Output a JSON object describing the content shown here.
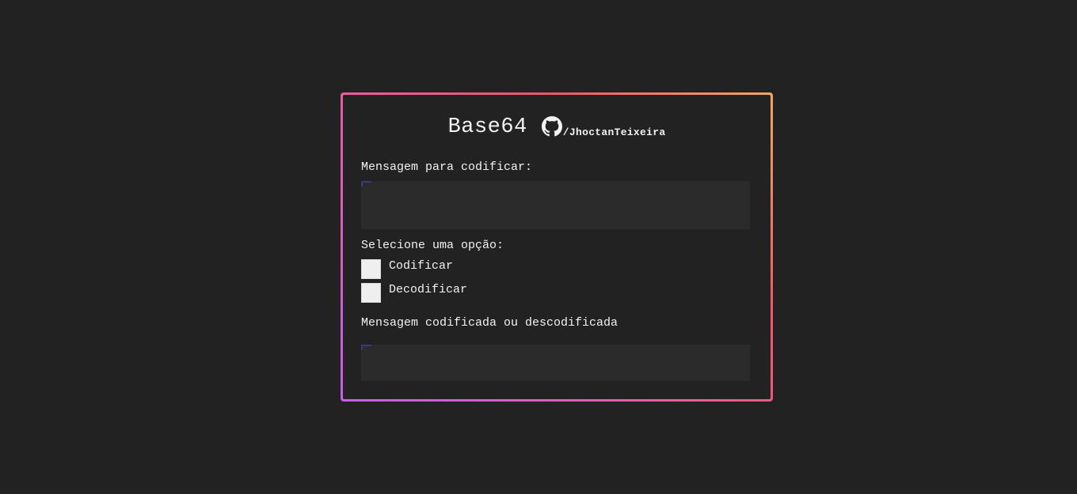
{
  "header": {
    "title": "Base64",
    "github_icon": "github-icon",
    "github_user": "/JhoctanTeixeira"
  },
  "input": {
    "label": "Mensagem para codificar:",
    "value": ""
  },
  "options": {
    "label": "Selecione uma opção:",
    "items": [
      {
        "label": "Codificar",
        "checked": false
      },
      {
        "label": "Decodificar",
        "checked": false
      }
    ]
  },
  "output": {
    "label": "Mensagem codificada ou descodificada",
    "value": ""
  },
  "colors": {
    "background": "#222222",
    "field": "#2b2b2b",
    "border_gradient": [
      "#c85cf0",
      "#ec5c9a",
      "#f0566c",
      "#f0a95e"
    ]
  }
}
